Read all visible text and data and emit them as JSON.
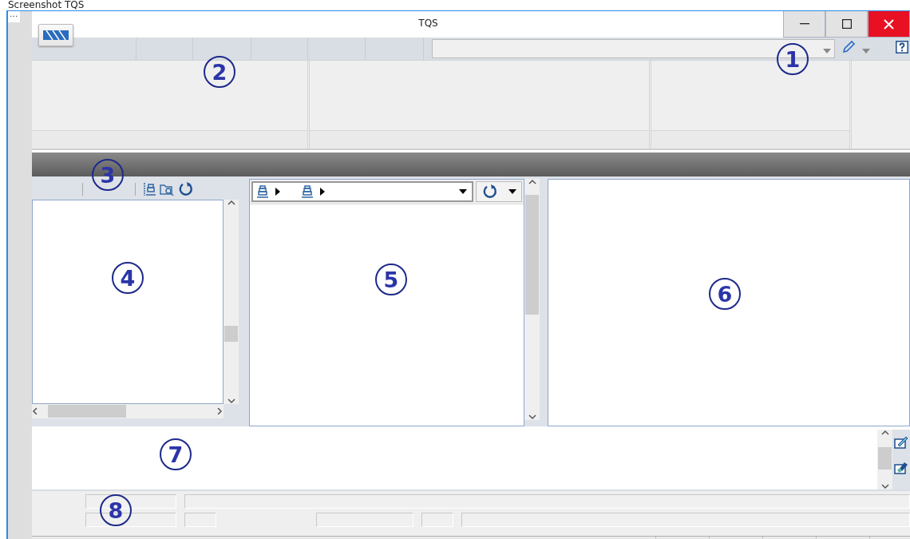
{
  "caption": "Screenshot TQS",
  "window": {
    "title": "TQS",
    "menu_dots": "..."
  },
  "callouts": [
    "1",
    "2",
    "3",
    "4",
    "5",
    "6",
    "7",
    "8"
  ]
}
